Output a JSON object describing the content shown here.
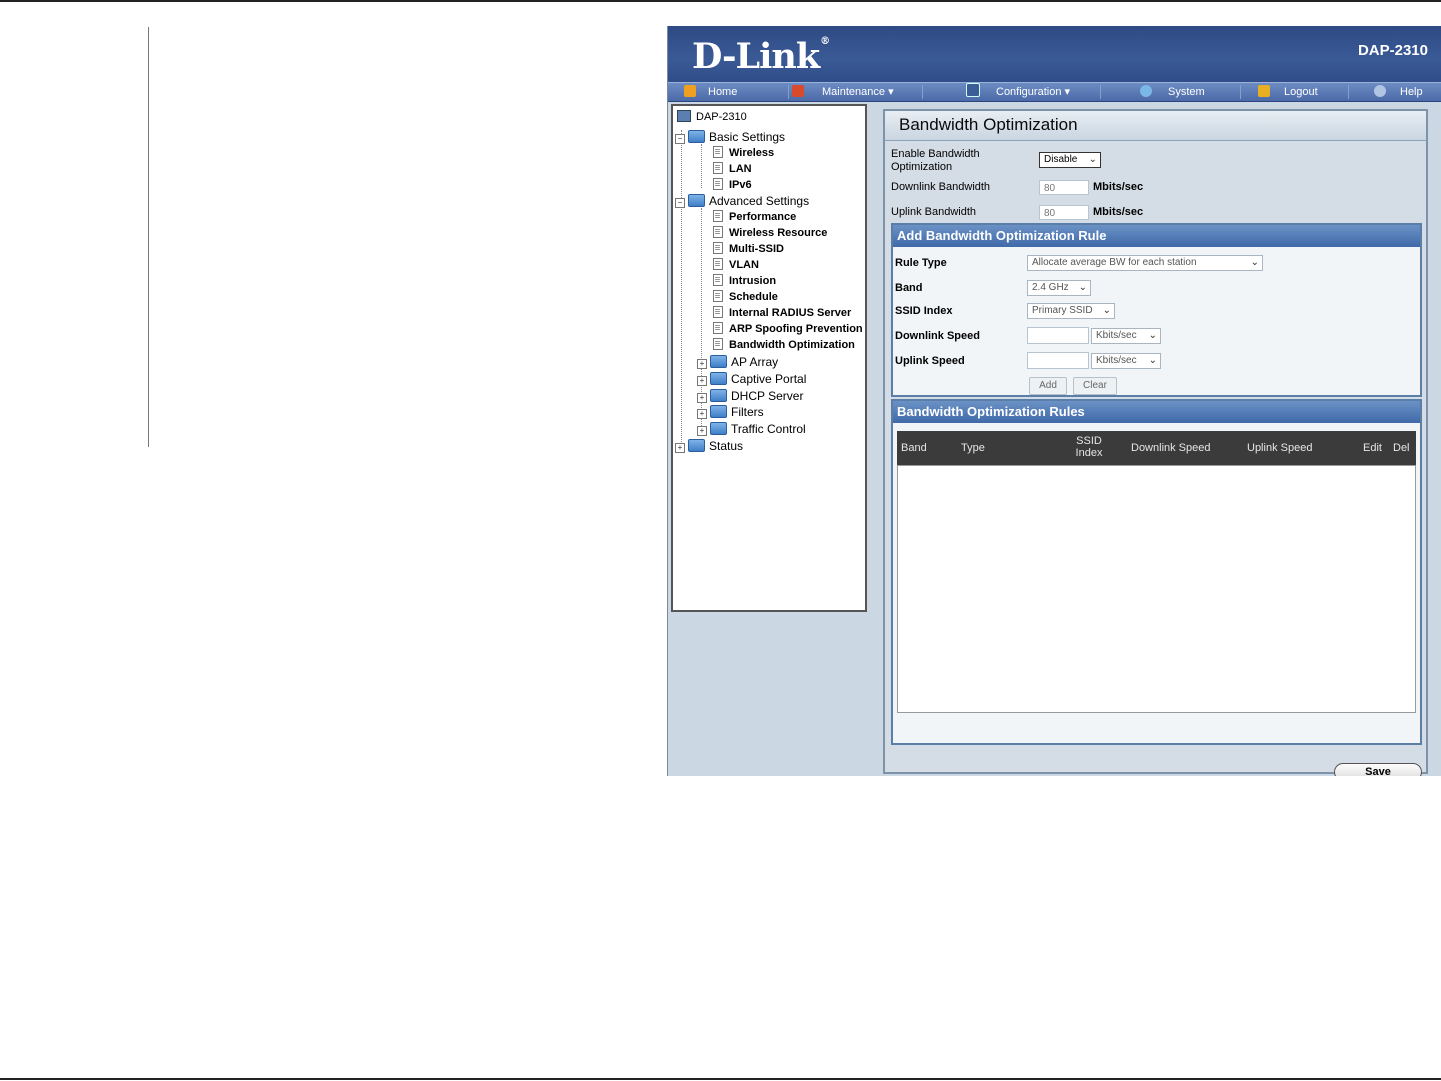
{
  "header": {
    "brand": "D-Link",
    "brand_mark": "®",
    "model": "DAP-2310"
  },
  "menu": [
    {
      "label": "Home",
      "icon": "home-icon"
    },
    {
      "label": "Maintenance",
      "icon": "tools-icon",
      "arrow": "▾"
    },
    {
      "label": "Configuration",
      "icon": "save-disk-icon",
      "arrow": "▾"
    },
    {
      "label": "System",
      "icon": "system-icon"
    },
    {
      "label": "Logout",
      "icon": "logout-icon"
    },
    {
      "label": "Help",
      "icon": "help-icon"
    }
  ],
  "tree": {
    "root": "DAP-2310",
    "basic": {
      "label": "Basic Settings",
      "items": [
        "Wireless",
        "LAN",
        "IPv6"
      ]
    },
    "advanced": {
      "label": "Advanced Settings",
      "items": [
        "Performance",
        "Wireless Resource",
        "Multi-SSID",
        "VLAN",
        "Intrusion",
        "Schedule",
        "Internal RADIUS Server",
        "ARP Spoofing Prevention",
        "Bandwidth Optimization"
      ],
      "folders": [
        "AP Array",
        "Captive Portal",
        "DHCP Server",
        "Filters",
        "Traffic Control"
      ]
    },
    "status": "Status",
    "expanded_sign": "−",
    "collapsed_sign": "+"
  },
  "page": {
    "title": "Bandwidth Optimization",
    "enable_label": "Enable Bandwidth Optimization",
    "enable_value": "Disable",
    "downlink_label": "Downlink Bandwidth",
    "downlink_value": "80",
    "uplink_label": "Uplink Bandwidth",
    "uplink_value": "80",
    "unit": "Mbits/sec"
  },
  "add_rule": {
    "title": "Add Bandwidth Optimization Rule",
    "rule_type_label": "Rule Type",
    "rule_type_value": "Allocate average BW for each station",
    "band_label": "Band",
    "band_value": "2.4 GHz",
    "ssid_label": "SSID Index",
    "ssid_value": "Primary SSID",
    "downlink_speed_label": "Downlink Speed",
    "uplink_speed_label": "Uplink Speed",
    "speed_unit": "Kbits/sec",
    "add_button": "Add",
    "clear_button": "Clear"
  },
  "rules": {
    "title": "Bandwidth Optimization Rules",
    "columns": {
      "band": "Band",
      "type": "Type",
      "ssid1": "SSID",
      "ssid2": "Index",
      "downlink": "Downlink Speed",
      "uplink": "Uplink Speed",
      "edit": "Edit",
      "del": "Del"
    }
  },
  "save_button": "Save",
  "chevron": "⌄"
}
